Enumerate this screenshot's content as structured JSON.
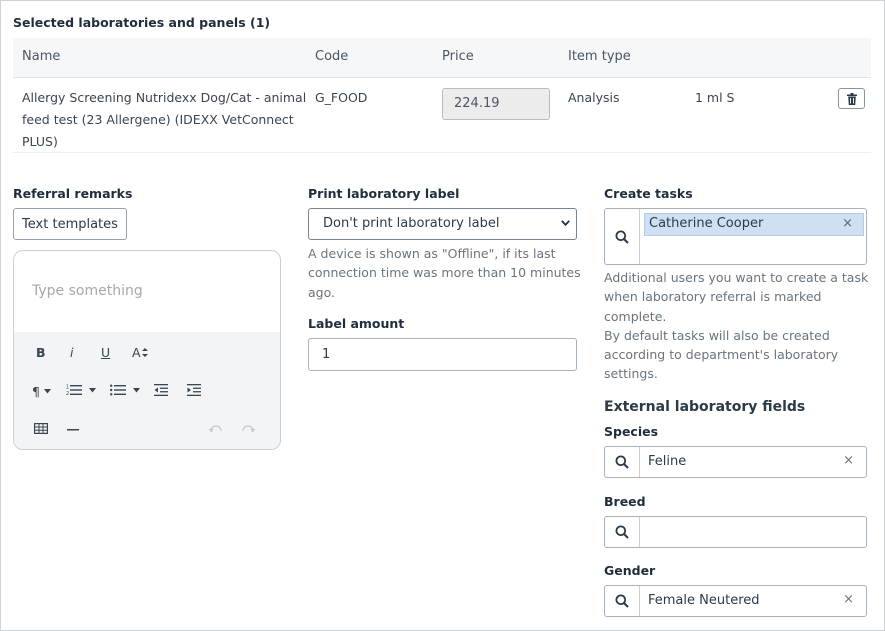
{
  "section_title": "Selected laboratories and panels (1)",
  "table": {
    "headers": {
      "name": "Name",
      "code": "Code",
      "price": "Price",
      "item_type": "Item type"
    },
    "row": {
      "name_lines": [
        "Allergy Screening Nutridexx Dog/Cat - animal",
        "feed test (23 Allergene) (IDEXX VetConnect",
        "PLUS)"
      ],
      "code": "G_FOOD",
      "price": "224.19",
      "item_type": "Analysis",
      "sample": "1 ml S"
    }
  },
  "referral": {
    "label": "Referral remarks",
    "templates_button": "Text templates",
    "placeholder": "Type something",
    "toolbar": {
      "bold": "B",
      "italic": "i",
      "underline": "U",
      "font_size": "A",
      "paragraph": "¶"
    }
  },
  "print_label": {
    "label": "Print laboratory label",
    "selected": "Don't print laboratory label",
    "help_lines": [
      "A device is shown as \"Offline\", if its last",
      "connection time was more than 10 minutes",
      "ago."
    ]
  },
  "label_amount": {
    "label": "Label amount",
    "value": "1"
  },
  "tasks": {
    "label": "Create tasks",
    "assignee": "Catherine Cooper",
    "help_lines": [
      "Additional users you want to create a task",
      "when laboratory referral is marked complete.",
      "By default tasks will also be created",
      "according to department's laboratory",
      "settings."
    ]
  },
  "external": {
    "heading": "External laboratory fields",
    "species": {
      "label": "Species",
      "value": "Feline"
    },
    "breed": {
      "label": "Breed",
      "value": ""
    },
    "gender": {
      "label": "Gender",
      "value": "Female Neutered"
    }
  },
  "icons": {
    "trash": "trash-icon",
    "search": "search-icon",
    "clear": "×"
  }
}
